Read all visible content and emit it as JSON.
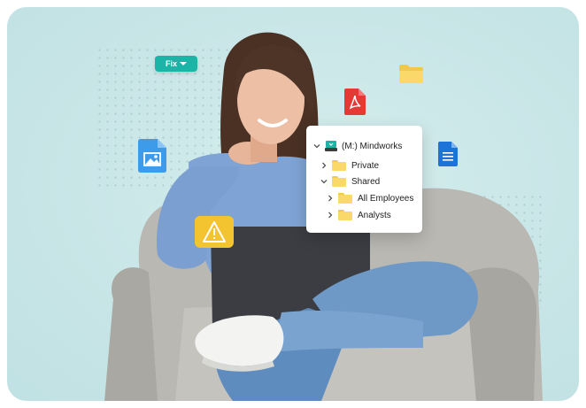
{
  "fix_button": {
    "label": "Fix"
  },
  "file_tree": {
    "drive": "(M:) Mindworks",
    "items": [
      {
        "label": "Private",
        "expanded": false
      },
      {
        "label": "Shared",
        "expanded": true
      },
      {
        "label": "All Employees",
        "expanded": false
      },
      {
        "label": "Analysts",
        "expanded": false
      }
    ]
  },
  "icons": [
    "image-file-icon",
    "warning-icon",
    "pdf-file-icon",
    "folder-icon",
    "document-file-icon"
  ],
  "colors": {
    "accent": "#1bb5a8",
    "background": "#cbe7e8",
    "folder": "#fbd86a",
    "pdf": "#e53935",
    "doc": "#1e88e5",
    "warning": "#f4c430"
  }
}
